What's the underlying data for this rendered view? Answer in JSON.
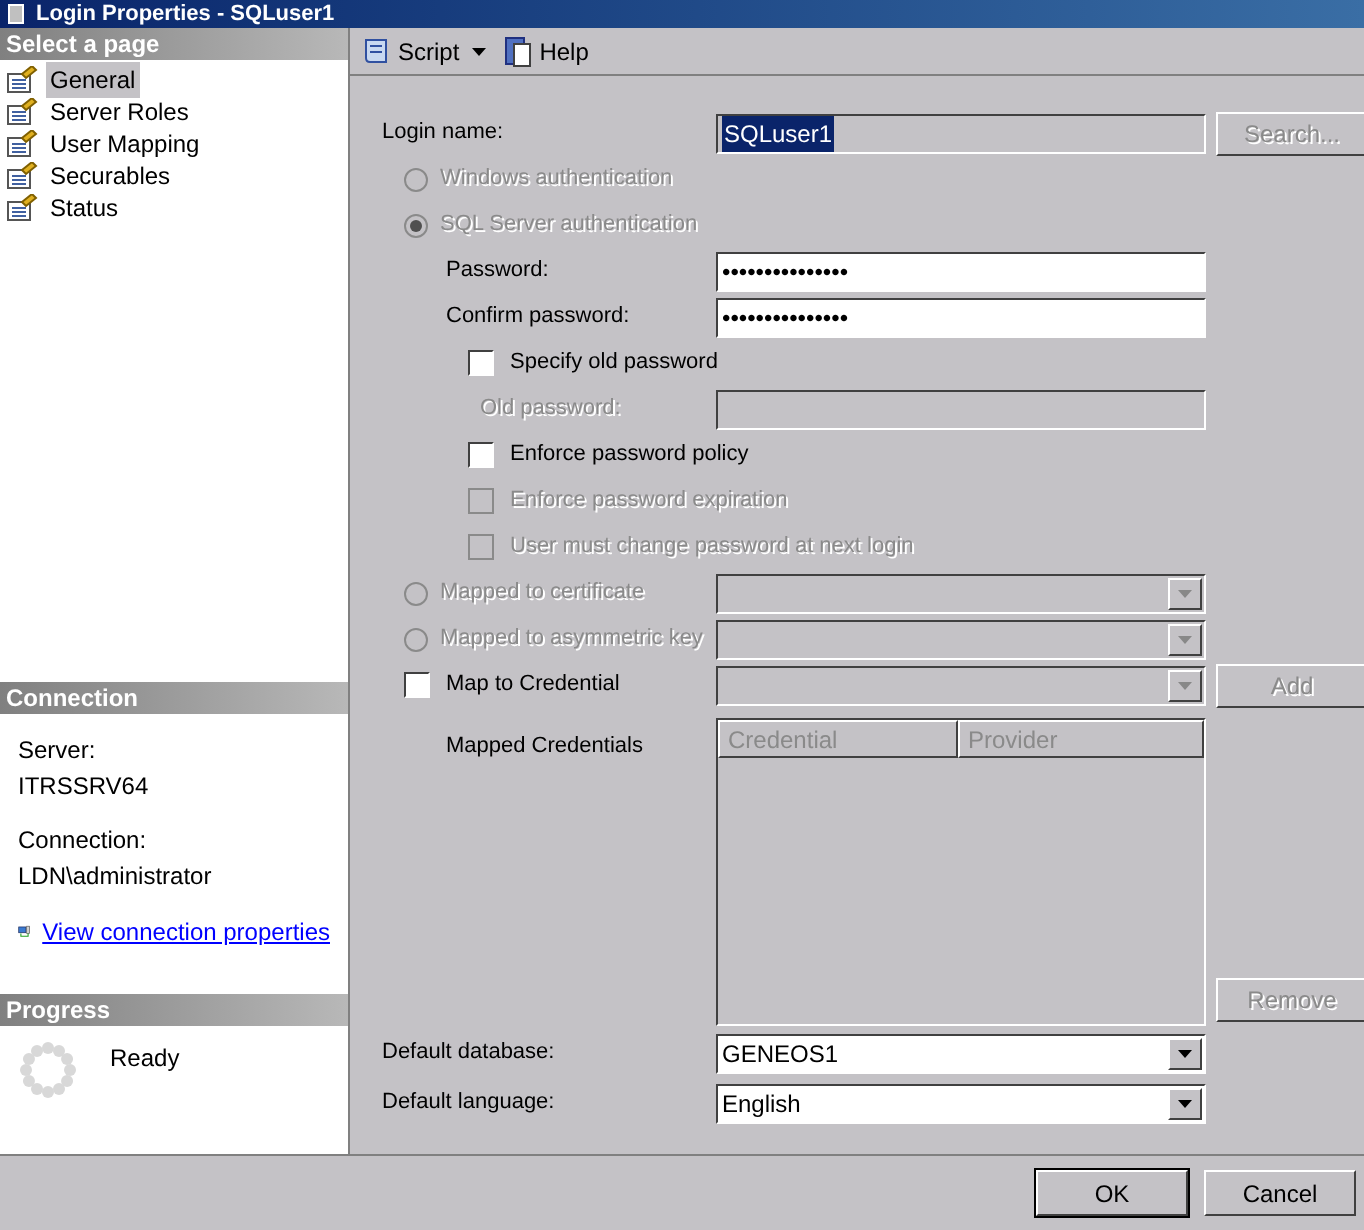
{
  "window": {
    "title": "Login Properties - SQLuser1"
  },
  "sidebar": {
    "header": "Select a page",
    "items": [
      {
        "label": "General",
        "selected": true
      },
      {
        "label": "Server Roles",
        "selected": false
      },
      {
        "label": "User Mapping",
        "selected": false
      },
      {
        "label": "Securables",
        "selected": false
      },
      {
        "label": "Status",
        "selected": false
      }
    ]
  },
  "connection": {
    "header": "Connection",
    "server_label": "Server:",
    "server": "ITRSSRV64",
    "connection_label": "Connection:",
    "connection": "LDN\\administrator",
    "link": "View connection properties"
  },
  "progress": {
    "header": "Progress",
    "status": "Ready"
  },
  "toolbar": {
    "items": [
      {
        "label": "Script",
        "kind": "dropdown"
      },
      {
        "label": "Help",
        "kind": "help"
      }
    ]
  },
  "form": {
    "rows": [
      {
        "kind": "field",
        "label": "Login name:",
        "value": "SQLuser1",
        "disabled": true,
        "button": {
          "label": "Search...",
          "disabled": true
        }
      },
      {
        "kind": "radio",
        "label": "Windows authentication",
        "selected": false,
        "disabled": true
      },
      {
        "kind": "radio",
        "label": "SQL Server authentication",
        "selected": true,
        "disabled": true,
        "children": [
          {
            "kind": "field",
            "label": "Password:",
            "value": "•••••••••••••••",
            "disabled": false
          },
          {
            "kind": "field",
            "label": "Confirm password:",
            "value": "•••••••••••••••",
            "disabled": false
          },
          {
            "kind": "checkbox",
            "label": "Specify old password",
            "checked": false,
            "disabled": false,
            "children": [
              {
                "kind": "field",
                "label": "Old password:",
                "disabled": true
              }
            ]
          },
          {
            "kind": "checkbox",
            "label": "Enforce password policy",
            "checked": false,
            "disabled": false
          },
          {
            "kind": "checkbox",
            "label": "Enforce password expiration",
            "checked": false,
            "disabled": true
          },
          {
            "kind": "checkbox",
            "label": "User must change password at next login",
            "checked": false,
            "disabled": true
          }
        ]
      },
      {
        "kind": "radio",
        "label": "Mapped to certificate",
        "selected": false,
        "disabled": true,
        "combo": {
          "disabled": true
        }
      },
      {
        "kind": "radio",
        "label": "Mapped to asymmetric key",
        "selected": false,
        "disabled": true,
        "combo": {
          "disabled": true
        }
      },
      {
        "kind": "checkbox",
        "label": "Map to Credential",
        "checked": false,
        "disabled": false,
        "combo": {
          "disabled": true
        },
        "button": {
          "label": "Add",
          "disabled": true
        }
      },
      {
        "kind": "grid",
        "label": "Mapped Credentials",
        "columns": [
          "Credential",
          "Provider"
        ],
        "button": {
          "label": "Remove",
          "disabled": true
        }
      },
      {
        "kind": "combo",
        "label": "Default database:",
        "value": "GENEOS1",
        "disabled": false
      },
      {
        "kind": "combo",
        "label": "Default language:",
        "value": "English",
        "disabled": false
      }
    ]
  },
  "buttons": [
    "OK",
    "Cancel"
  ]
}
